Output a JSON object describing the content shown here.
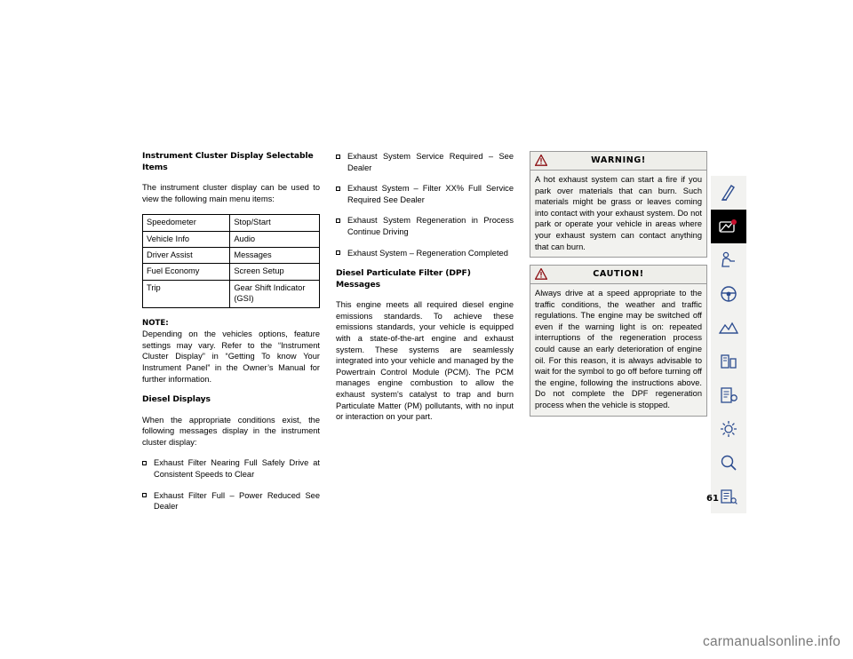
{
  "page": {
    "number": "61",
    "watermark": "carmanualsonline.info"
  },
  "left_column": {
    "heading": "Instrument Cluster Display Selectable Items",
    "intro": "The instrument cluster display can be used to view the following main menu items:",
    "table": {
      "rows": [
        [
          "Speedometer",
          "Stop/Start"
        ],
        [
          "Vehicle Info",
          "Audio"
        ],
        [
          "Driver Assist",
          "Messages"
        ],
        [
          "Fuel Economy",
          "Screen Setup"
        ],
        [
          "Trip",
          "Gear Shift Indicator (GSI)"
        ]
      ]
    },
    "note_label": "NOTE:",
    "note_text": "Depending on the vehicles options, feature settings may vary. Refer to the “Instrument Cluster Display” in “Getting To know Your Instrument Panel” in the Owner’s Manual for further information.",
    "diesel_heading": "Diesel Displays",
    "diesel_intro": "When the appropriate conditions exist, the following messages display in the instrument cluster display:",
    "messages": [
      "Exhaust Filter Nearing Full Safely Drive at Consistent Speeds to Clear",
      "Exhaust Filter Full – Power Reduced See Dealer"
    ]
  },
  "mid_column": {
    "messages": [
      "Exhaust System Service Required – See Dealer",
      "Exhaust System – Filter XX% Full Service Required See Dealer",
      "Exhaust System Regeneration in Process Continue Driving",
      "Exhaust System – Regeneration Completed"
    ],
    "dpf_heading": "Diesel Particulate Filter (DPF) Messages",
    "dpf_text": "This engine meets all required diesel engine emissions standards. To achieve these emissions standards, your vehicle is equipped with a state-of-the-art engine and exhaust system. These systems are seamlessly integrated into your vehicle and managed by the Powertrain Control Module (PCM). The PCM manages engine combustion to allow the exhaust system's catalyst to trap and burn Particulate Matter (PM) pollutants, with no input or interaction on your part."
  },
  "warning_box": {
    "title": "WARNING!",
    "icon": "warning-triangle-icon",
    "text": "A hot exhaust system can start a fire if you park over materials that can burn. Such materials might be grass or leaves coming into contact with your exhaust system. Do not park or operate your vehicle in areas where your exhaust system can contact anything that can burn."
  },
  "caution_box": {
    "title": "CAUTION!",
    "icon": "caution-triangle-icon",
    "text": "Always drive at a speed appropriate to the traffic conditions, the weather and traffic regulations. The engine may be switched off even if the warning light is on: repeated interruptions of the regeneration process could cause an early deterioration of engine oil. For this reason, it is always advisable to wait for the symbol to go off before turning off the engine, following the instructions above. Do not complete the DPF regeneration process when the vehicle is stopped.",
    "accent_color": "#8c0f13"
  },
  "icon_rail": {
    "items": [
      {
        "name": "tab-icon-seat-belt",
        "active": false
      },
      {
        "name": "tab-icon-maintenance-wrench",
        "active": true
      },
      {
        "name": "tab-icon-child-seat",
        "active": false
      },
      {
        "name": "tab-icon-steering-wheel",
        "active": false
      },
      {
        "name": "tab-icon-off-road-terrain",
        "active": false
      },
      {
        "name": "tab-icon-roadside-assistance",
        "active": false
      },
      {
        "name": "tab-icon-multimedia",
        "active": false
      },
      {
        "name": "tab-icon-service-tools",
        "active": false
      },
      {
        "name": "tab-icon-search",
        "active": false
      },
      {
        "name": "tab-icon-index",
        "active": false
      }
    ]
  }
}
